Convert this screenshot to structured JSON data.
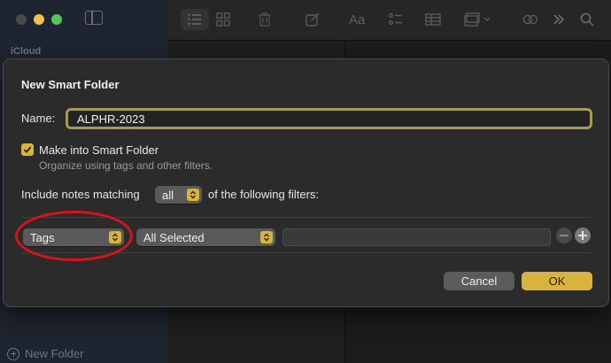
{
  "app": {
    "sidebar_section": "iCloud",
    "new_folder_label": "New Folder"
  },
  "dialog": {
    "title": "New Smart Folder",
    "name_label": "Name:",
    "name_value": "ALPHR-2023",
    "smart_folder_checkbox": {
      "label": "Make into Smart Folder",
      "checked": true,
      "description": "Organize using tags and other filters."
    },
    "include_prefix": "Include notes matching",
    "match_mode": "all",
    "include_suffix": "of the following filters:",
    "filter": {
      "field": "Tags",
      "condition": "All Selected",
      "value": ""
    },
    "cancel_label": "Cancel",
    "ok_label": "OK"
  },
  "colors": {
    "accent": "#d9b43c",
    "highlight_ellipse": "#d8131b"
  }
}
